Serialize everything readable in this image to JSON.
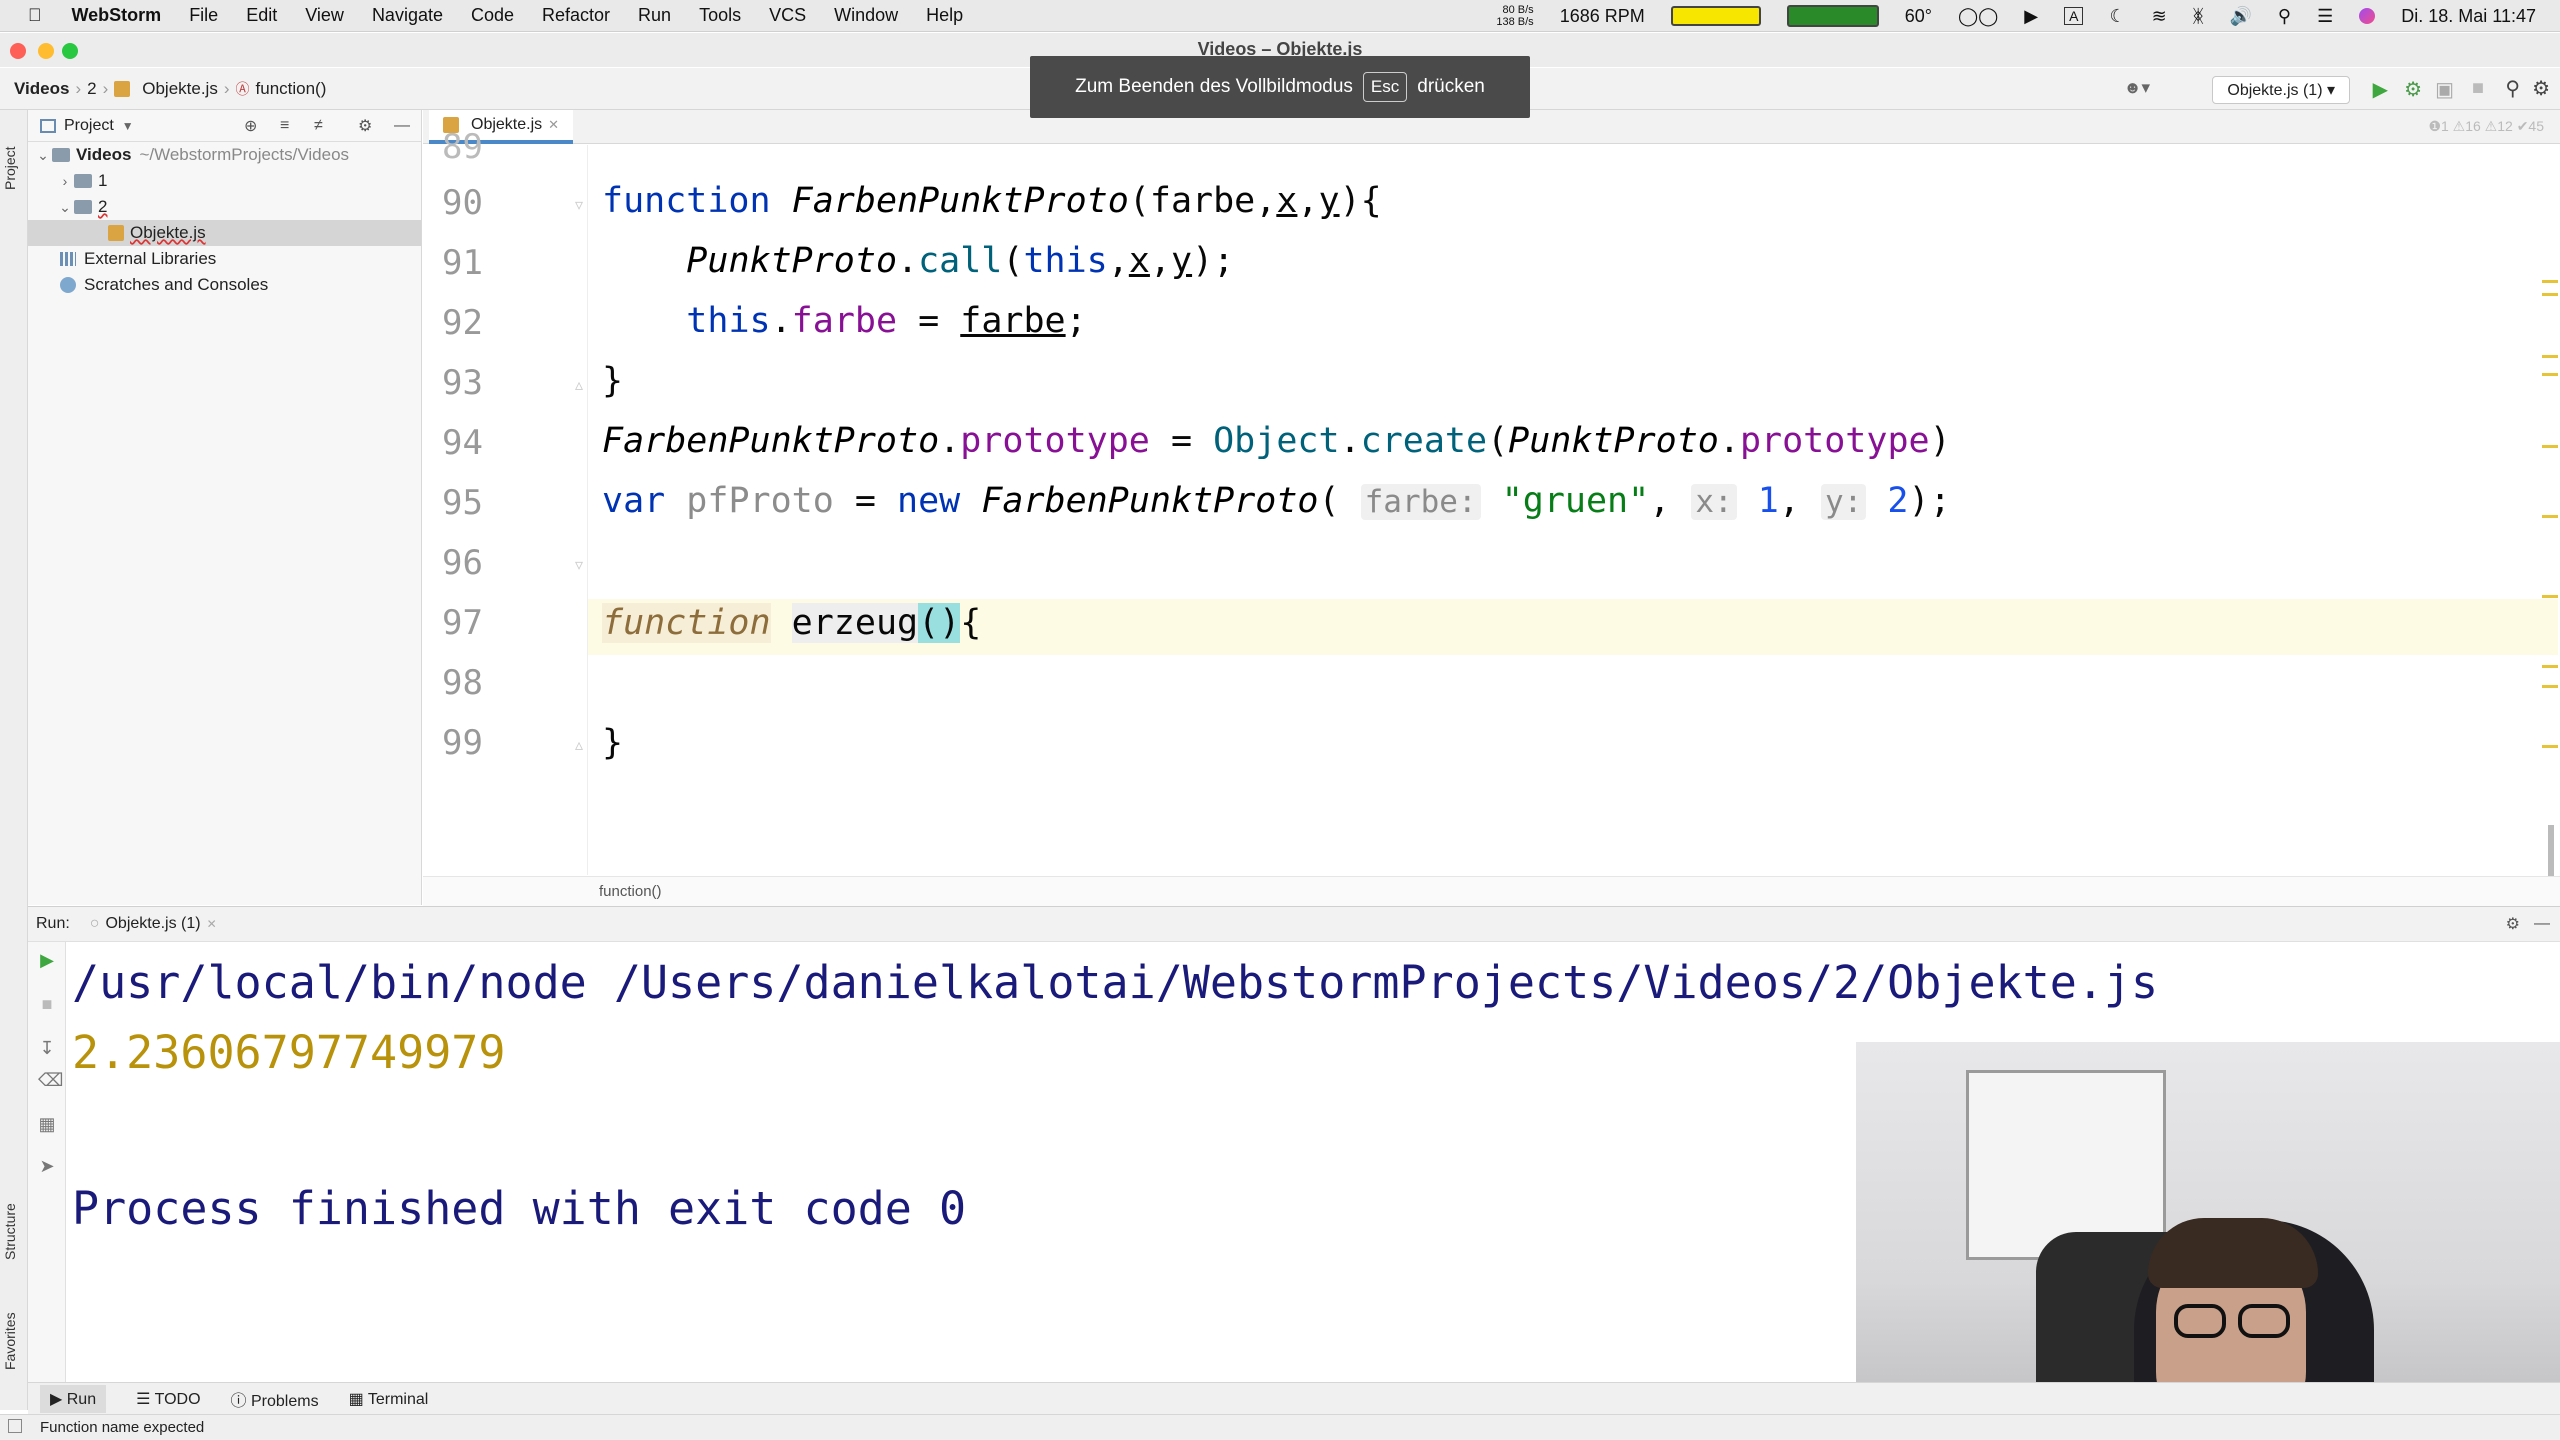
{
  "menubar": {
    "app_name": "WebStorm",
    "items": [
      "File",
      "Edit",
      "View",
      "Navigate",
      "Code",
      "Refactor",
      "Run",
      "Tools",
      "VCS",
      "Window",
      "Help"
    ],
    "net_up": "80 B/s",
    "net_down": "138 B/s",
    "fan": "1686 RPM",
    "temp": "60°",
    "clock": "Di. 18. Mai  11:47"
  },
  "window": {
    "title": "Videos – Objekte.js"
  },
  "toast": {
    "text_before": "Zum Beenden des Vollbildmodus",
    "key": "Esc",
    "text_after": "drücken"
  },
  "navbar": {
    "crumbs": [
      "Videos",
      "2",
      "Objekte.js",
      "function()"
    ],
    "run_config": "Objekte.js (1)"
  },
  "sidebar_labels": {
    "project": "Project",
    "structure": "Structure",
    "favorites": "Favorites"
  },
  "project": {
    "title": "Project",
    "root_name": "Videos",
    "root_path": "~/WebstormProjects/Videos",
    "folder1": "1",
    "folder2": "2",
    "file": "Objekte.js",
    "external": "External Libraries",
    "scratches": "Scratches and Consoles"
  },
  "editor": {
    "tab": "Objekte.js",
    "inspections": "❶1  ⚠16  ⚠12  ✔45",
    "lines": [
      "90",
      "91",
      "92",
      "93",
      "94",
      "95",
      "96",
      "97",
      "98",
      "99"
    ],
    "breadcrumb": "function()"
  },
  "run": {
    "label": "Run:",
    "tab": "Objekte.js (1)",
    "cmd": "/usr/local/bin/node /Users/danielkalotai/WebstormProjects/Videos/2/Objekte.js",
    "output": "2.23606797749979",
    "exit": "Process finished with exit code 0"
  },
  "bottom_tabs": [
    "Run",
    "TODO",
    "Problems",
    "Terminal"
  ],
  "status": "Function name expected",
  "colors": {
    "keyword": "#0033b3",
    "property": "#871094",
    "string": "#067d17",
    "number": "#1750eb",
    "output": "#b8920a"
  }
}
